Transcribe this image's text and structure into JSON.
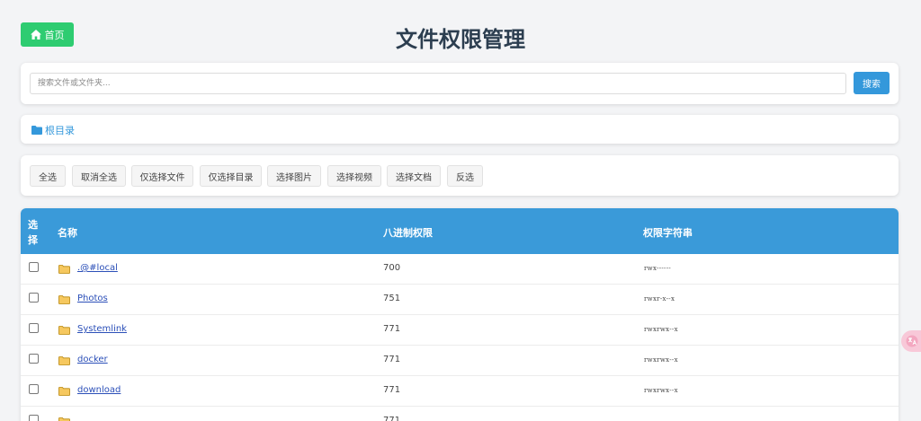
{
  "header": {
    "home_label": "首页",
    "title": "文件权限管理"
  },
  "search": {
    "placeholder": "搜索文件或文件夹...",
    "value": "",
    "button_label": "搜索"
  },
  "breadcrumb": {
    "root_label": "根目录"
  },
  "actions": [
    "全选",
    "取消全选",
    "仅选择文件",
    "仅选择目录",
    "选择图片",
    "选择视频",
    "选择文档",
    "反选"
  ],
  "table": {
    "columns": {
      "select": "选择",
      "name": "名称",
      "octal": "八进制权限",
      "perm": "权限字符串"
    },
    "rows": [
      {
        "name": ".@#local",
        "octal": "700",
        "perm": "rwx------"
      },
      {
        "name": "Photos",
        "octal": "751",
        "perm": "rwxr-x--x"
      },
      {
        "name": "Systemlink",
        "octal": "771",
        "perm": "rwxrwx--x"
      },
      {
        "name": "docker",
        "octal": "771",
        "perm": "rwxrwx--x"
      },
      {
        "name": "download",
        "octal": "771",
        "perm": "rwxrwx--x"
      },
      {
        "name": "",
        "octal": "771",
        "perm": ""
      }
    ]
  },
  "colors": {
    "home_green": "#2ecc71",
    "accent_blue": "#3498db",
    "header_blue": "#3a9ad9",
    "title_dark": "#2c3e50"
  },
  "icons": {
    "home": "home-icon",
    "folder": "folder-icon",
    "translate": "translate-icon"
  }
}
